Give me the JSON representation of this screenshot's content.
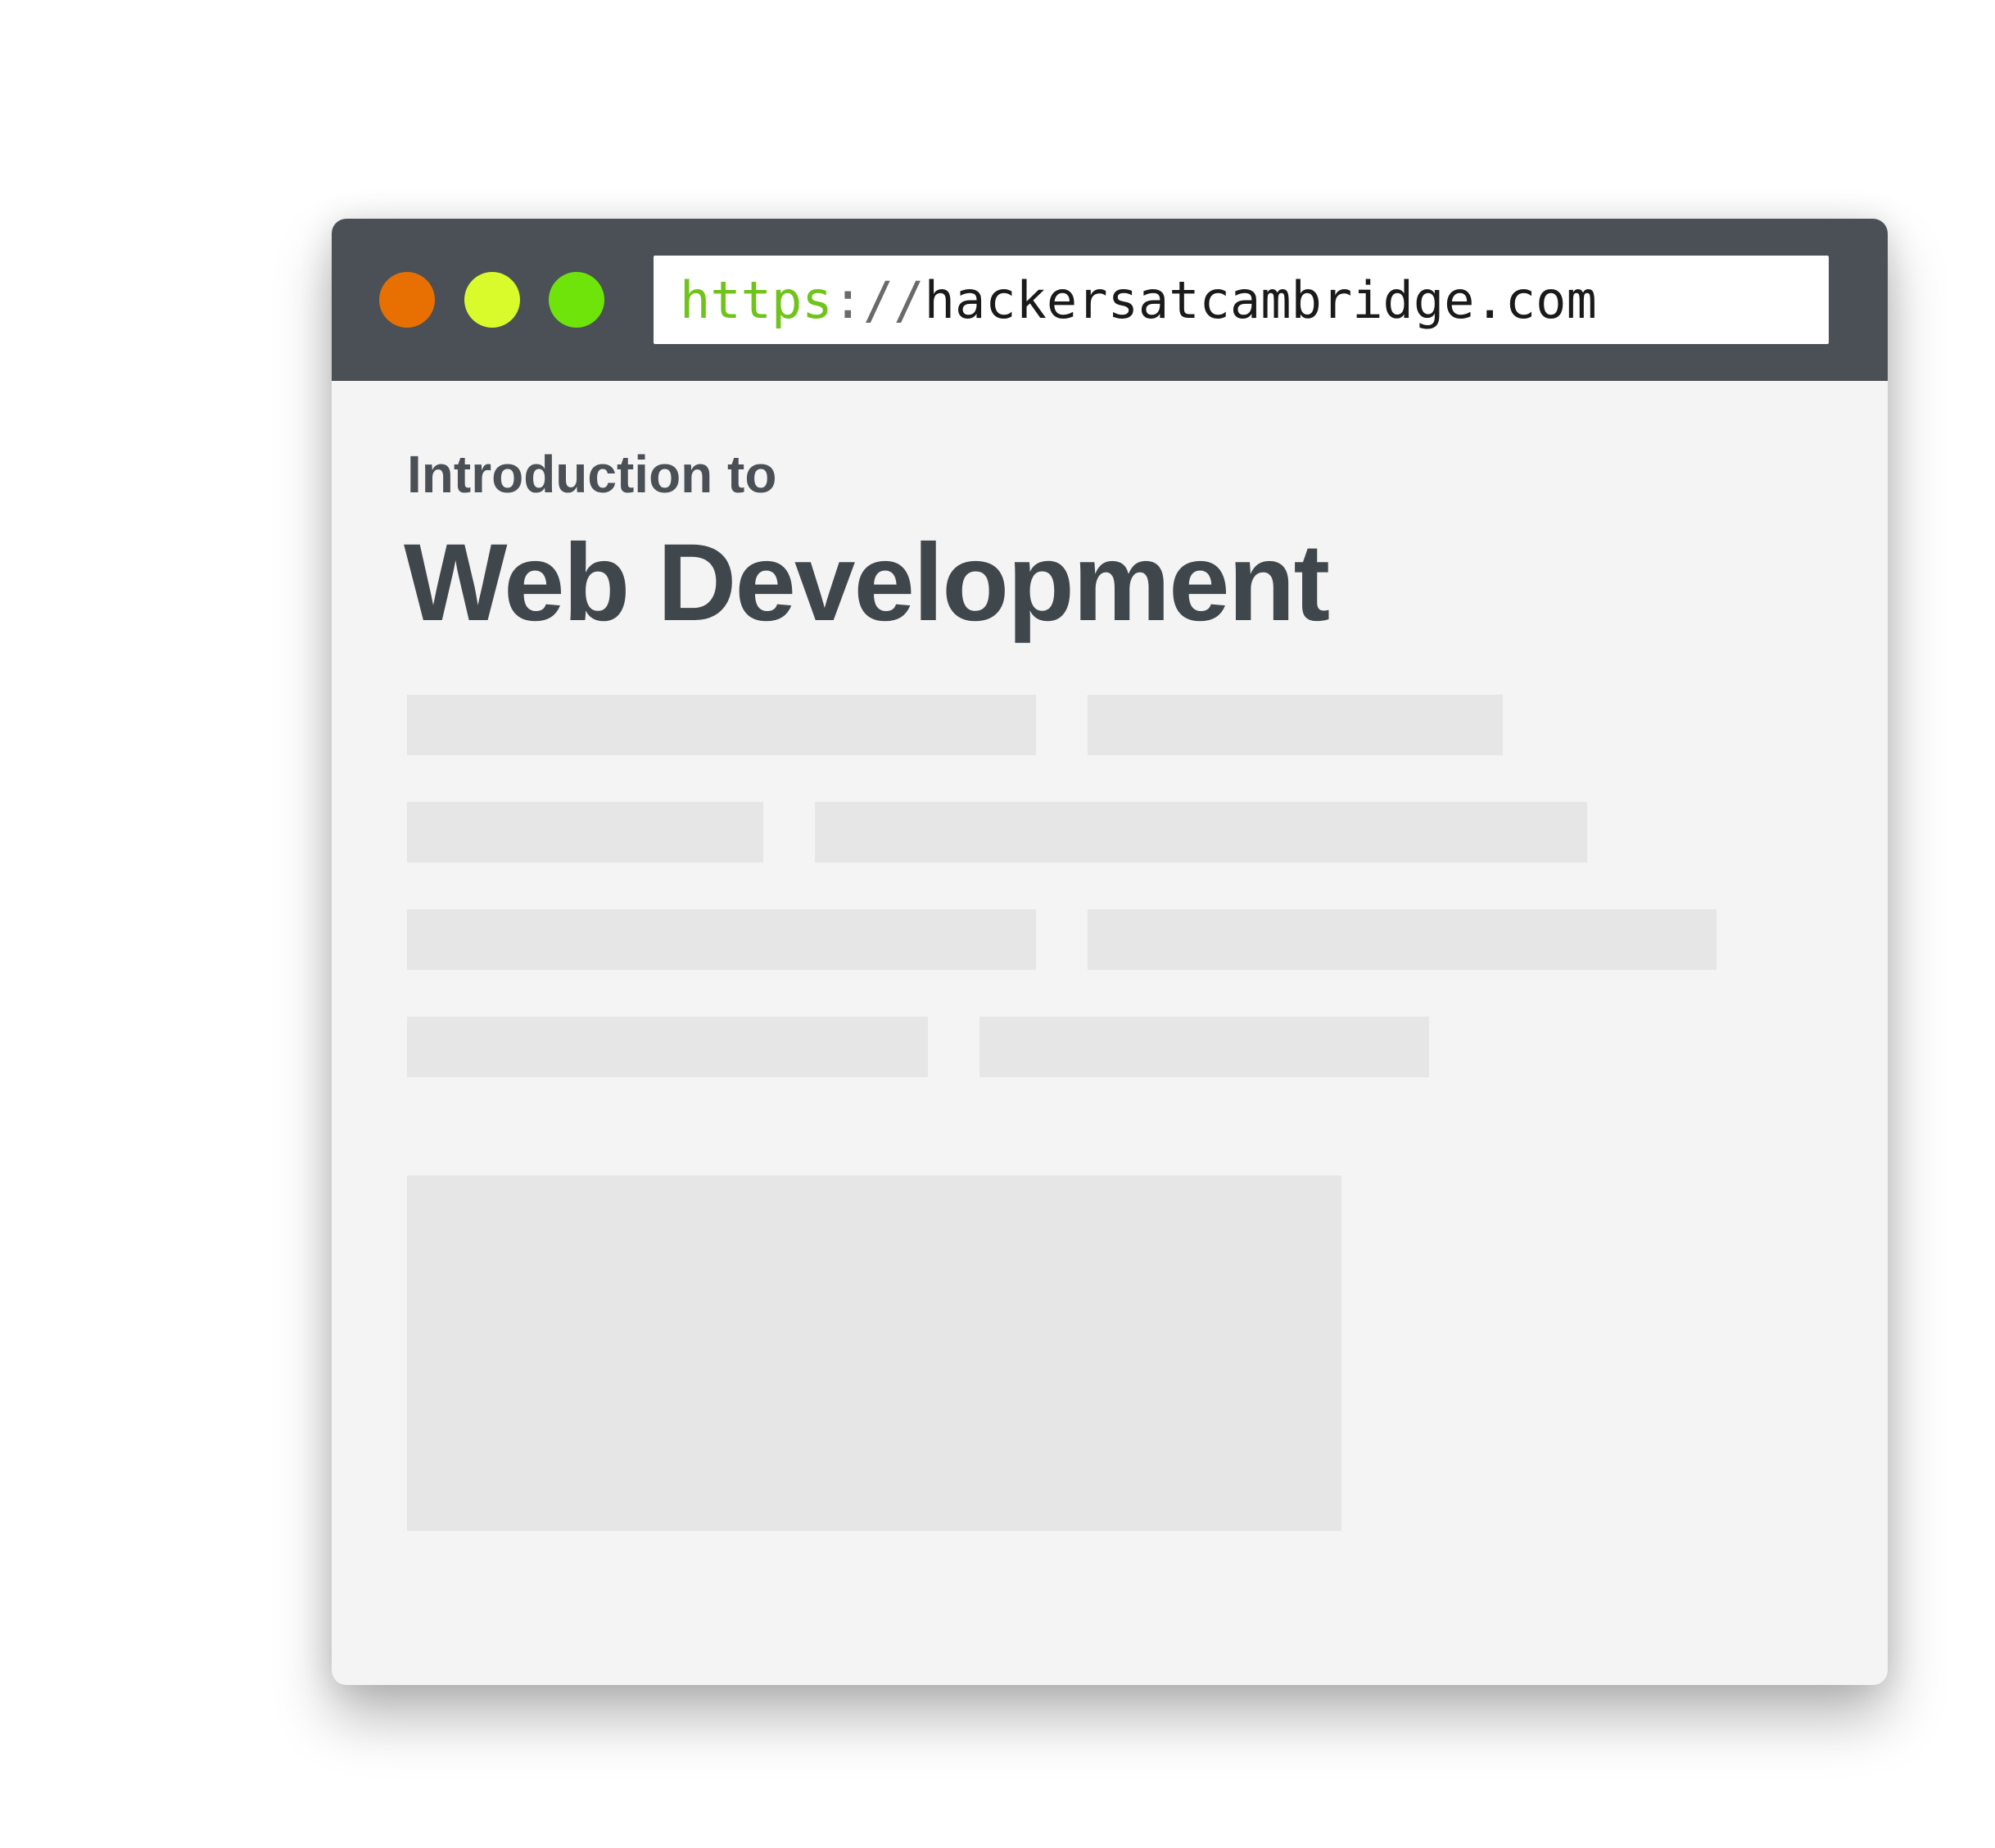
{
  "window": {
    "controls": [
      {
        "name": "close",
        "color": "#e86f02"
      },
      {
        "name": "minimize",
        "color": "#dafb2b"
      },
      {
        "name": "maximize",
        "color": "#6fe40a"
      }
    ]
  },
  "address_bar": {
    "scheme": "https",
    "separator": "://",
    "host": "hackersatcambridge.com"
  },
  "page": {
    "subtitle": "Introduction to",
    "title": "Web Development"
  },
  "colors": {
    "toolbar": "#4a5055",
    "page_background": "#f4f4f4",
    "placeholder": "#e6e6e6",
    "url_scheme": "#6fc31a",
    "heading": "#40474c"
  }
}
